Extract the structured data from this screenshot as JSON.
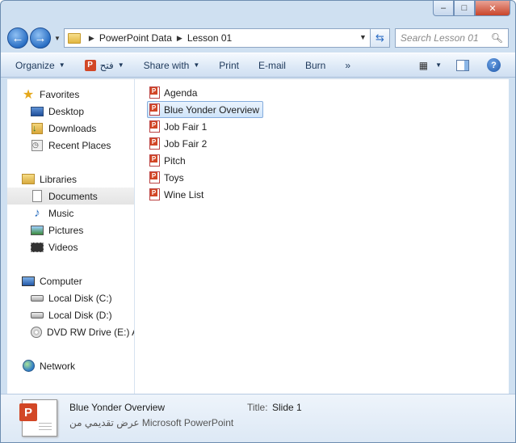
{
  "window": {
    "caption": {
      "minimize": "–",
      "maximize": "□",
      "close": "✕"
    }
  },
  "navigation": {
    "back_glyph": "←",
    "forward_glyph": "→",
    "breadcrumb": [
      "PowerPoint Data",
      "Lesson 01"
    ],
    "search_placeholder": "Search Lesson 01"
  },
  "toolbar": {
    "organize": "Organize",
    "open_label": "فتح",
    "share_with": "Share with",
    "print": "Print",
    "email": "E-mail",
    "burn": "Burn",
    "more": "»"
  },
  "nav_pane": {
    "favorites": {
      "label": "Favorites",
      "items": [
        "Desktop",
        "Downloads",
        "Recent Places"
      ]
    },
    "libraries": {
      "label": "Libraries",
      "items": [
        "Documents",
        "Music",
        "Pictures",
        "Videos"
      ],
      "selected": "Documents"
    },
    "computer": {
      "label": "Computer",
      "items": [
        "Local Disk (C:)",
        "Local Disk (D:)",
        "DVD RW Drive (E:) A"
      ]
    },
    "network": {
      "label": "Network"
    }
  },
  "files": {
    "items": [
      "Agenda",
      "Blue Yonder Overview",
      "Job Fair 1",
      "Job Fair 2",
      "Pitch",
      "Toys",
      "Wine List"
    ],
    "selected": "Blue Yonder Overview",
    "icon_letter": "P"
  },
  "details": {
    "name": "Blue Yonder Overview",
    "type_ar": "عرض تقديمي من",
    "type_en": "Microsoft PowerPoint",
    "title_label": "Title:",
    "title_value": "Slide 1"
  },
  "colors": {
    "accent": "#2a6fc4",
    "ppt_orange": "#d24726",
    "selection_border": "#84acdd"
  }
}
